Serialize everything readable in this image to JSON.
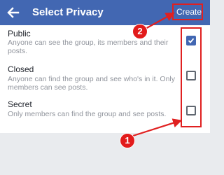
{
  "header": {
    "back_icon": "arrow-left-icon",
    "title": "Select Privacy",
    "create_label": "Create"
  },
  "options": [
    {
      "title": "Public",
      "description": "Anyone can see the group, its members and their posts.",
      "checked": true
    },
    {
      "title": "Closed",
      "description": "Anyone can find the group and see who's in it. Only members can see posts.",
      "checked": false
    },
    {
      "title": "Secret",
      "description": "Only members can find the group and see posts.",
      "checked": false
    }
  ],
  "annotations": {
    "badge_1": "1",
    "badge_2": "2",
    "highlight_color": "#e02020"
  },
  "colors": {
    "brand": "#4267b2",
    "background": "#e9ebee"
  }
}
